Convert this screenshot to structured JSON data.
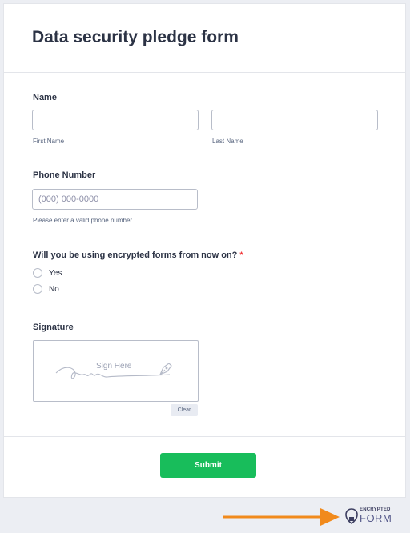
{
  "form": {
    "title": "Data security pledge form",
    "name": {
      "label": "Name",
      "first_sublabel": "First Name",
      "last_sublabel": "Last Name",
      "first_value": "",
      "last_value": ""
    },
    "phone": {
      "label": "Phone Number",
      "placeholder": "(000) 000-0000",
      "value": "",
      "hint": "Please enter a valid phone number."
    },
    "question": {
      "label": "Will you be using encrypted forms from now on?",
      "required_mark": "*",
      "options": [
        "Yes",
        "No"
      ]
    },
    "signature": {
      "label": "Signature",
      "placeholder_text": "Sign Here",
      "clear_label": "Clear"
    },
    "submit_label": "Submit"
  },
  "footer": {
    "logo_top": "ENCRYPTED",
    "logo_bottom": "FORM",
    "arrow_color": "#f18a1c"
  },
  "colors": {
    "submit": "#18bd5b",
    "required": "#f23a3c"
  }
}
